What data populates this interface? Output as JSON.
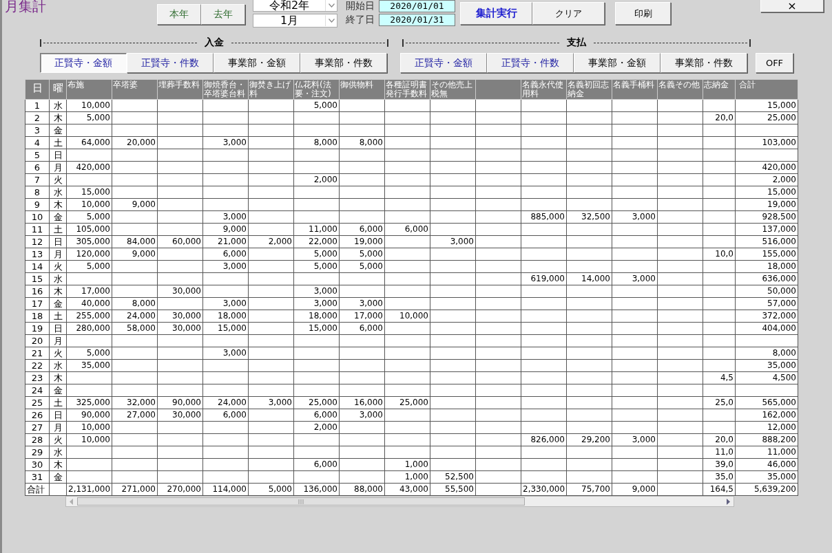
{
  "window": {
    "title": "月集計",
    "close": "×"
  },
  "year_buttons": [
    {
      "label": "本年"
    },
    {
      "label": "去年"
    }
  ],
  "era_select": {
    "value": "令和2年"
  },
  "month_select": {
    "value": "1月"
  },
  "dates": [
    {
      "label": "開始日",
      "value": "2020/01/01"
    },
    {
      "label": "終了日",
      "value": "2020/01/31"
    }
  ],
  "actions": [
    {
      "label": "集計実行",
      "kind": "primary"
    },
    {
      "label": "クリア",
      "kind": "normal"
    },
    {
      "label": "印刷",
      "kind": "normal"
    }
  ],
  "groups": [
    {
      "title": "入金",
      "buttons": [
        {
          "label": "正賢寺・金額",
          "selected": true,
          "kind": "temple"
        },
        {
          "label": "正賢寺・件数",
          "selected": false,
          "kind": "temple"
        },
        {
          "label": "事業部・金額",
          "selected": false,
          "kind": "dept"
        },
        {
          "label": "事業部・件数",
          "selected": false,
          "kind": "dept"
        }
      ]
    },
    {
      "title": "支払",
      "buttons": [
        {
          "label": "正賢寺・金額",
          "selected": false,
          "kind": "temple"
        },
        {
          "label": "正賢寺・件数",
          "selected": false,
          "kind": "temple"
        },
        {
          "label": "事業部・金額",
          "selected": false,
          "kind": "dept"
        },
        {
          "label": "事業部・件数",
          "selected": false,
          "kind": "dept"
        }
      ]
    }
  ],
  "off_button": "OFF",
  "table": {
    "columns": [
      "日",
      "曜",
      "布施",
      "卒塔婆",
      "埋葬手数料",
      "御焼香台・卒塔婆台料",
      "御焚き上げ料",
      "仏花料(法要・注文)",
      "御供物料",
      "各種証明書発行手数料",
      "その他売上税無",
      null,
      "名義永代使用料",
      "名義初回志納金",
      "名義手桶料",
      "名義その他",
      "志納金",
      "合計"
    ],
    "rows": [
      {
        "cells": [
          "1",
          "水",
          "10,000",
          null,
          null,
          null,
          null,
          "5,000",
          null,
          null,
          null,
          null,
          null,
          null,
          null,
          null,
          null,
          "15,000"
        ]
      },
      {
        "cells": [
          "2",
          "木",
          "5,000",
          null,
          null,
          null,
          null,
          null,
          null,
          null,
          null,
          null,
          null,
          null,
          null,
          null,
          "20,0",
          "25,000"
        ]
      },
      {
        "cells": [
          "3",
          "金",
          null,
          null,
          null,
          null,
          null,
          null,
          null,
          null,
          null,
          null,
          null,
          null,
          null,
          null,
          null,
          null
        ]
      },
      {
        "cells": [
          "4",
          "土",
          "64,000",
          "20,000",
          null,
          "3,000",
          null,
          "8,000",
          "8,000",
          null,
          null,
          null,
          null,
          null,
          null,
          null,
          null,
          "103,000"
        ]
      },
      {
        "cells": [
          "5",
          "日",
          null,
          null,
          null,
          null,
          null,
          null,
          null,
          null,
          null,
          null,
          null,
          null,
          null,
          null,
          null,
          null
        ]
      },
      {
        "cells": [
          "6",
          "月",
          "420,000",
          null,
          null,
          null,
          null,
          null,
          null,
          null,
          null,
          null,
          null,
          null,
          null,
          null,
          null,
          "420,000"
        ]
      },
      {
        "cells": [
          "7",
          "火",
          null,
          null,
          null,
          null,
          null,
          "2,000",
          null,
          null,
          null,
          null,
          null,
          null,
          null,
          null,
          null,
          "2,000"
        ]
      },
      {
        "cells": [
          "8",
          "水",
          "15,000",
          null,
          null,
          null,
          null,
          null,
          null,
          null,
          null,
          null,
          null,
          null,
          null,
          null,
          null,
          "15,000"
        ]
      },
      {
        "cells": [
          "9",
          "木",
          "10,000",
          "9,000",
          null,
          null,
          null,
          null,
          null,
          null,
          null,
          null,
          null,
          null,
          null,
          null,
          null,
          "19,000"
        ]
      },
      {
        "cells": [
          "10",
          "金",
          "5,000",
          null,
          null,
          "3,000",
          null,
          null,
          null,
          null,
          null,
          null,
          "885,000",
          "32,500",
          "3,000",
          null,
          null,
          "928,500"
        ]
      },
      {
        "cells": [
          "11",
          "土",
          "105,000",
          null,
          null,
          "9,000",
          null,
          "11,000",
          "6,000",
          "6,000",
          null,
          null,
          null,
          null,
          null,
          null,
          null,
          "137,000"
        ]
      },
      {
        "cells": [
          "12",
          "日",
          "305,000",
          "84,000",
          "60,000",
          "21,000",
          "2,000",
          "22,000",
          "19,000",
          null,
          "3,000",
          null,
          null,
          null,
          null,
          null,
          null,
          "516,000"
        ]
      },
      {
        "cells": [
          "13",
          "月",
          "120,000",
          "9,000",
          null,
          "6,000",
          null,
          "5,000",
          "5,000",
          null,
          null,
          null,
          null,
          null,
          null,
          null,
          "10,0",
          "155,000"
        ]
      },
      {
        "cells": [
          "14",
          "火",
          "5,000",
          null,
          null,
          "3,000",
          null,
          "5,000",
          "5,000",
          null,
          null,
          null,
          null,
          null,
          null,
          null,
          null,
          "18,000"
        ]
      },
      {
        "cells": [
          "15",
          "水",
          null,
          null,
          null,
          null,
          null,
          null,
          null,
          null,
          null,
          null,
          "619,000",
          "14,000",
          "3,000",
          null,
          null,
          "636,000"
        ]
      },
      {
        "cells": [
          "16",
          "木",
          "17,000",
          null,
          "30,000",
          null,
          null,
          "3,000",
          null,
          null,
          null,
          null,
          null,
          null,
          null,
          null,
          null,
          "50,000"
        ]
      },
      {
        "cells": [
          "17",
          "金",
          "40,000",
          "8,000",
          null,
          "3,000",
          null,
          "3,000",
          "3,000",
          null,
          null,
          null,
          null,
          null,
          null,
          null,
          null,
          "57,000"
        ]
      },
      {
        "cells": [
          "18",
          "土",
          "255,000",
          "24,000",
          "30,000",
          "18,000",
          null,
          "18,000",
          "17,000",
          "10,000",
          null,
          null,
          null,
          null,
          null,
          null,
          null,
          "372,000"
        ]
      },
      {
        "cells": [
          "19",
          "日",
          "280,000",
          "58,000",
          "30,000",
          "15,000",
          null,
          "15,000",
          "6,000",
          null,
          null,
          null,
          null,
          null,
          null,
          null,
          null,
          "404,000"
        ]
      },
      {
        "cells": [
          "20",
          "月",
          null,
          null,
          null,
          null,
          null,
          null,
          null,
          null,
          null,
          null,
          null,
          null,
          null,
          null,
          null,
          null
        ]
      },
      {
        "cells": [
          "21",
          "火",
          "5,000",
          null,
          null,
          "3,000",
          null,
          null,
          null,
          null,
          null,
          null,
          null,
          null,
          null,
          null,
          null,
          "8,000"
        ]
      },
      {
        "cells": [
          "22",
          "水",
          "35,000",
          null,
          null,
          null,
          null,
          null,
          null,
          null,
          null,
          null,
          null,
          null,
          null,
          null,
          null,
          "35,000"
        ]
      },
      {
        "cells": [
          "23",
          "木",
          null,
          null,
          null,
          null,
          null,
          null,
          null,
          null,
          null,
          null,
          null,
          null,
          null,
          null,
          "4,5",
          "4,500"
        ]
      },
      {
        "cells": [
          "24",
          "金",
          null,
          null,
          null,
          null,
          null,
          null,
          null,
          null,
          null,
          null,
          null,
          null,
          null,
          null,
          null,
          null
        ]
      },
      {
        "cells": [
          "25",
          "土",
          "325,000",
          "32,000",
          "90,000",
          "24,000",
          "3,000",
          "25,000",
          "16,000",
          "25,000",
          null,
          null,
          null,
          null,
          null,
          null,
          "25,0",
          "565,000"
        ]
      },
      {
        "cells": [
          "26",
          "日",
          "90,000",
          "27,000",
          "30,000",
          "6,000",
          null,
          "6,000",
          "3,000",
          null,
          null,
          null,
          null,
          null,
          null,
          null,
          null,
          "162,000"
        ]
      },
      {
        "cells": [
          "27",
          "月",
          "10,000",
          null,
          null,
          null,
          null,
          "2,000",
          null,
          null,
          null,
          null,
          null,
          null,
          null,
          null,
          null,
          "12,000"
        ]
      },
      {
        "cells": [
          "28",
          "火",
          "10,000",
          null,
          null,
          null,
          null,
          null,
          null,
          null,
          null,
          null,
          "826,000",
          "29,200",
          "3,000",
          null,
          "20,0",
          "888,200"
        ]
      },
      {
        "cells": [
          "29",
          "水",
          null,
          null,
          null,
          null,
          null,
          null,
          null,
          null,
          null,
          null,
          null,
          null,
          null,
          null,
          "11,0",
          "11,000"
        ]
      },
      {
        "cells": [
          "30",
          "木",
          null,
          null,
          null,
          null,
          null,
          "6,000",
          null,
          "1,000",
          null,
          null,
          null,
          null,
          null,
          null,
          "39,0",
          "46,000"
        ]
      },
      {
        "cells": [
          "31",
          "金",
          null,
          null,
          null,
          null,
          null,
          null,
          null,
          "1,000",
          "52,500",
          null,
          null,
          null,
          null,
          null,
          "35,0",
          "35,000"
        ]
      }
    ],
    "total_row": {
      "cells": [
        "合計",
        null,
        "2,131,000",
        "271,000",
        "270,000",
        "114,000",
        "5,000",
        "136,000",
        "88,000",
        "43,000",
        "55,500",
        null,
        "2,330,000",
        "75,700",
        "9,000",
        null,
        "164,5",
        "5,639,200"
      ]
    }
  }
}
